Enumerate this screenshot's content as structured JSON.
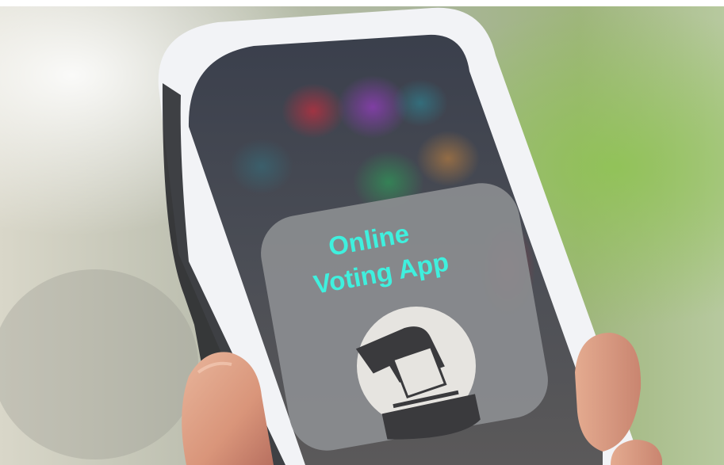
{
  "app_title": {
    "line1": "Online",
    "line2": "Voting App"
  },
  "icon": "ballot-box-icon",
  "colors": {
    "title_text": "#3ff0de",
    "phone_frame": "#f2f3f6",
    "screen_tile": "#8b8d90",
    "icon_disc": "#e6e4e0",
    "icon_glyph": "#3a3a3d"
  }
}
